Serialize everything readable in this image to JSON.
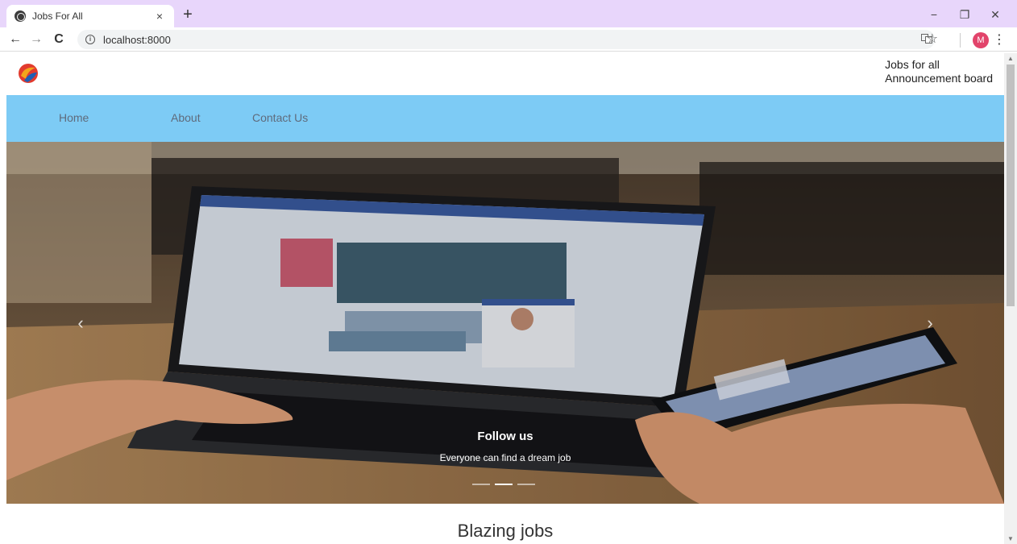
{
  "browser": {
    "tab_title": "Jobs For All",
    "tab_close": "×",
    "new_tab": "+",
    "controls": {
      "minimize": "−",
      "maximize": "❐",
      "close": "✕"
    },
    "back": "←",
    "forward": "→",
    "reload": "C",
    "url": "localhost:8000",
    "profile_initial": "M",
    "menu": "⋮",
    "star": "☆",
    "colors": {
      "tabstrip": "#e8d6fb",
      "avatar": "#e2446b"
    }
  },
  "site": {
    "header_line1": "Jobs for all",
    "header_line2": "Announcement board",
    "nav": [
      "Home",
      "About",
      "Contact Us"
    ],
    "colors": {
      "navbar": "#7dcbf5",
      "nav_text": "#5f6b7c"
    }
  },
  "carousel": {
    "title": "Follow us",
    "subtitle": "Everyone can find a dream job",
    "prev": "‹",
    "next": "›",
    "active_slide": 2,
    "slide_count": 3
  },
  "section": {
    "title": "Blazing jobs"
  }
}
